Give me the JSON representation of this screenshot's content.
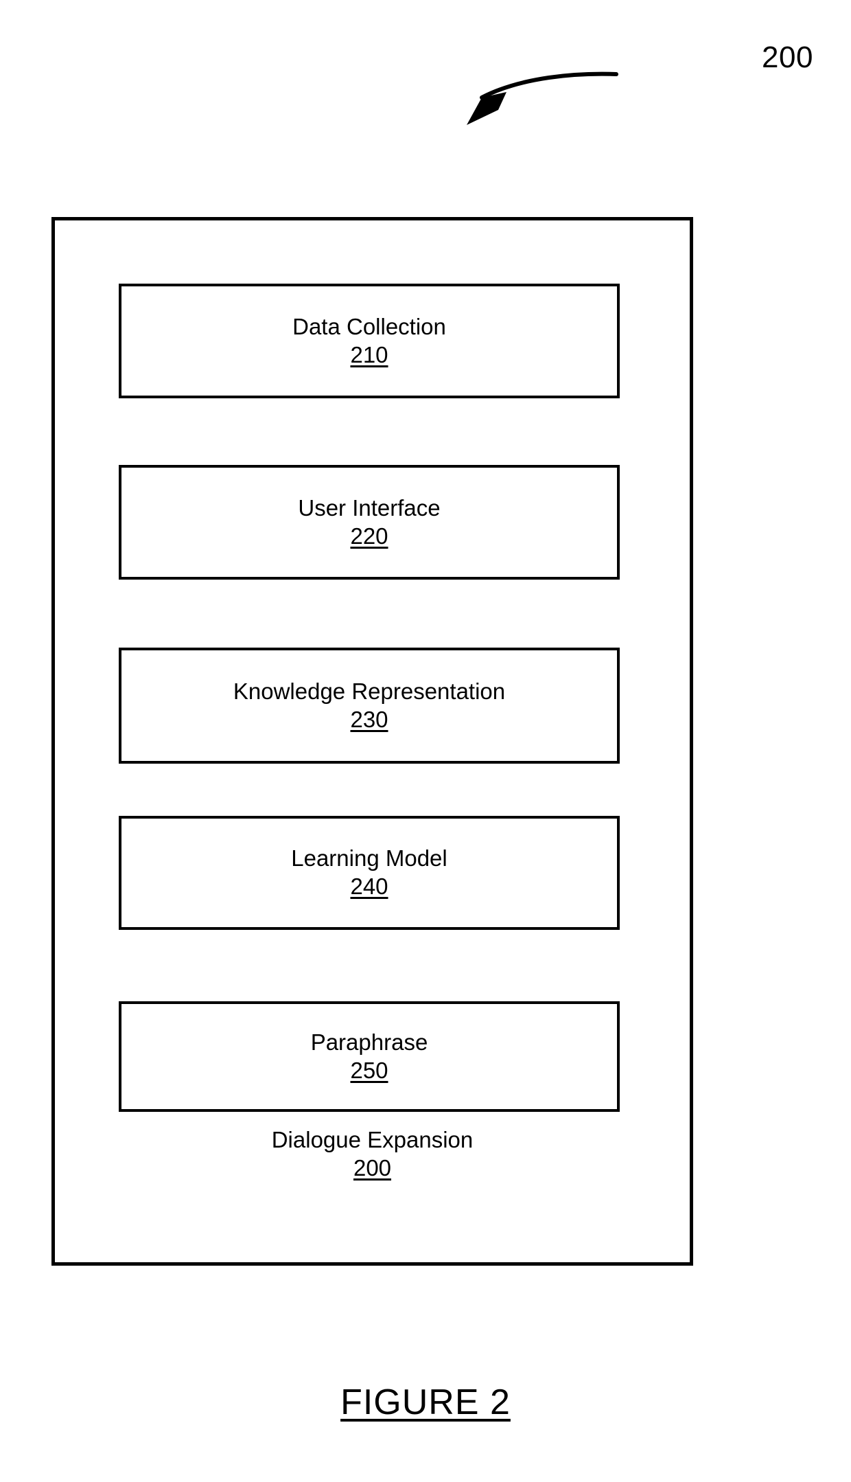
{
  "figure": {
    "caption": "FIGURE 2",
    "callout_reference": "200"
  },
  "diagram": {
    "container": {
      "label": "Dialogue Expansion",
      "reference": "200"
    },
    "components": [
      {
        "label": "Data Collection",
        "reference": "210"
      },
      {
        "label": "User Interface",
        "reference": "220"
      },
      {
        "label": "Knowledge Representation",
        "reference": "230"
      },
      {
        "label": "Learning Model",
        "reference": "240"
      },
      {
        "label": "Paraphrase",
        "reference": "250"
      }
    ]
  },
  "style": {
    "line_color": "#000000",
    "background_color": "#ffffff"
  }
}
